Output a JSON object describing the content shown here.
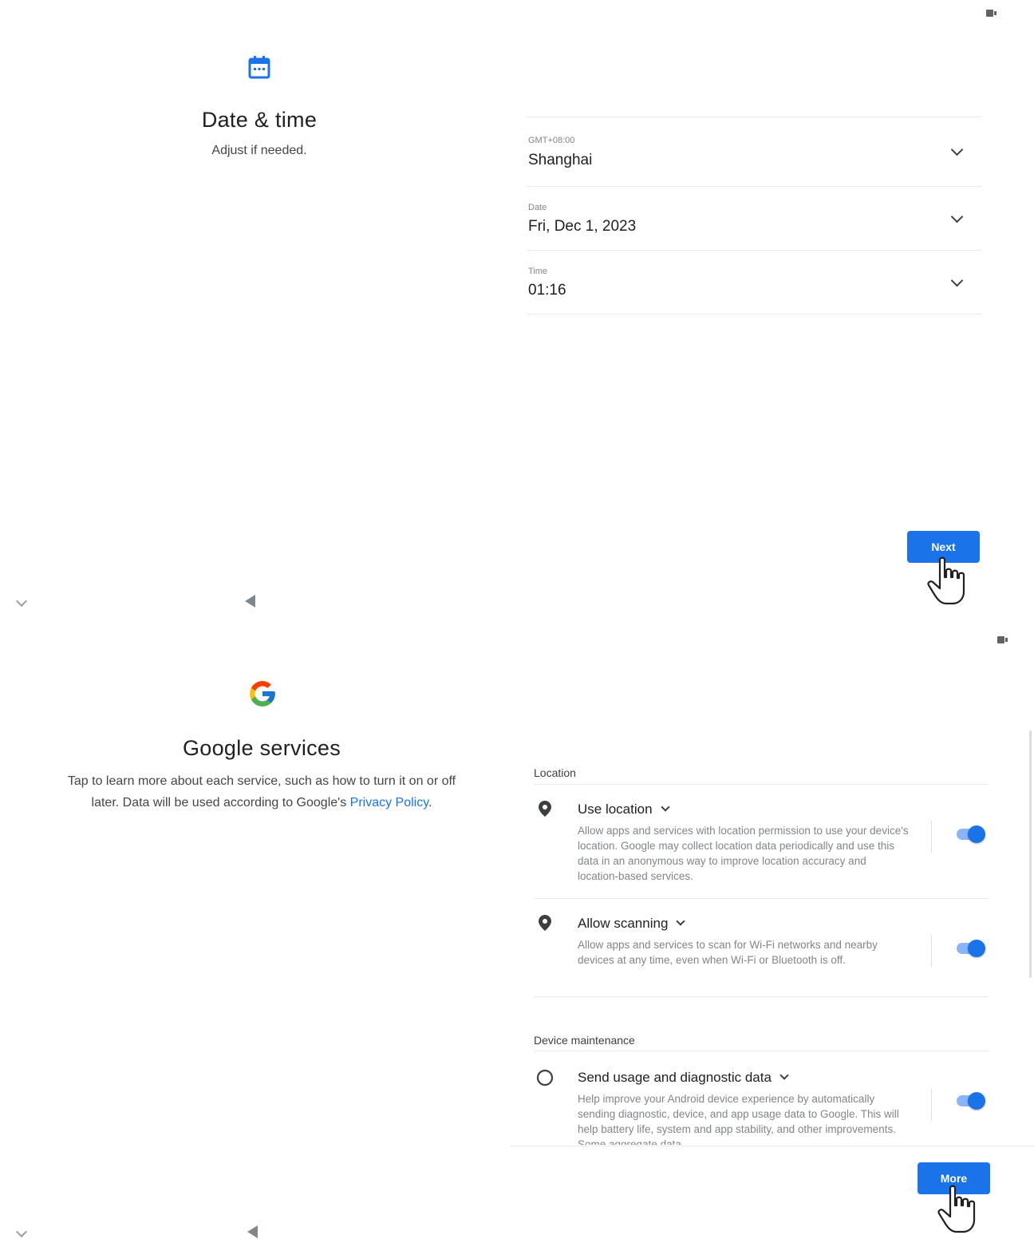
{
  "screen1": {
    "title": "Date & time",
    "subtitle": "Adjust if needed.",
    "icon": "calendar-icon",
    "accent": "#1a73e8",
    "fields": [
      {
        "label": "GMT+08:00",
        "value": "Shanghai"
      },
      {
        "label": "Date",
        "value": "Fri, Dec 1, 2023"
      },
      {
        "label": "Time",
        "value": "01:16"
      }
    ],
    "next_label": "Next"
  },
  "screen2": {
    "title": "Google services",
    "description_part1": "Tap to learn more about each service, such as how to turn it on or off",
    "description_part2": "later. Data will be used according to Google's ",
    "privacy_link": "Privacy Policy",
    "description_end": ".",
    "sections": {
      "location": "Location",
      "maintenance": "Device maintenance"
    },
    "services": [
      {
        "title": "Use location",
        "icon": "location-pin-icon",
        "on": true,
        "desc": "Allow apps and services with location permission to use your device's location. Google may collect location data periodically and use this data in an anonymous way to improve location accuracy and location-based services."
      },
      {
        "title": "Allow scanning",
        "icon": "location-pin-icon",
        "on": true,
        "desc": "Allow apps and services to scan for Wi-Fi networks and nearby devices at any time, even when Wi-Fi or Bluetooth is off."
      },
      {
        "title": "Send usage and diagnostic data",
        "icon": "circle-icon",
        "on": true,
        "desc": "Help improve your Android device experience by automatically sending diagnostic, device, and app usage data to Google. This will help battery life, system and app stability, and other improvements. Some aggregate data"
      }
    ],
    "more_label": "More"
  }
}
